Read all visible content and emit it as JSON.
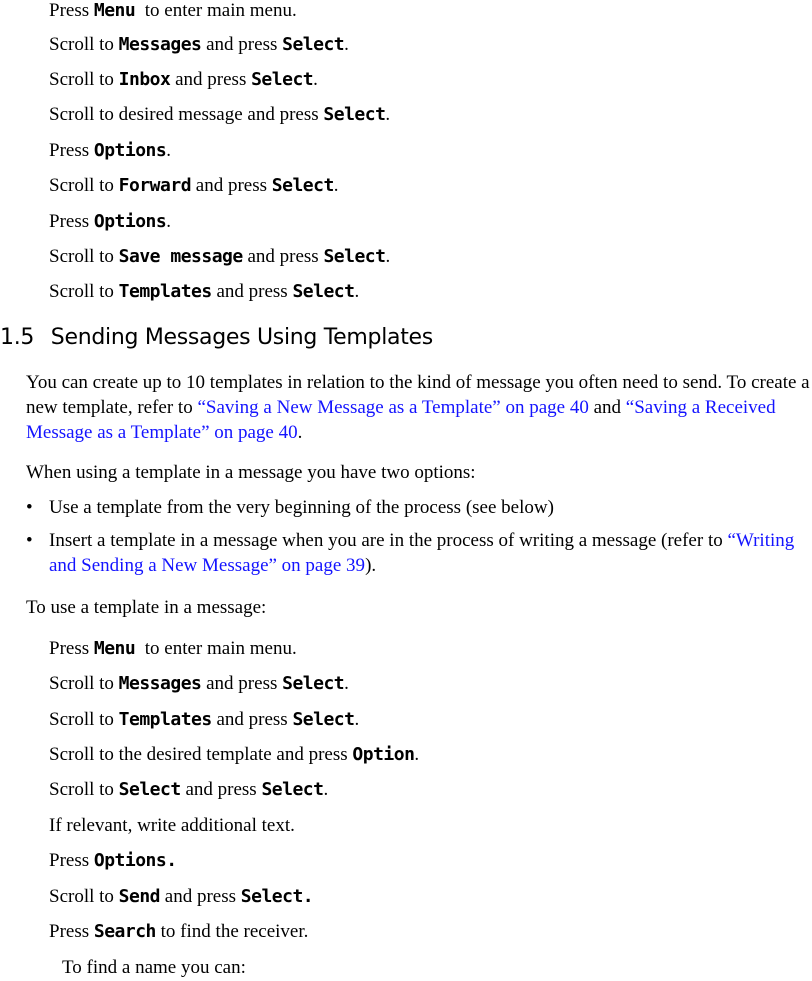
{
  "top_steps": [
    {
      "pre": "Press ",
      "key1": "Menu",
      "mid": "  to enter main menu.",
      "key2": "",
      "post": ""
    },
    {
      "pre": "Scroll to ",
      "key1": "Messages",
      "mid": " and press ",
      "key2": "Select",
      "post": "."
    },
    {
      "pre": "Scroll to ",
      "key1": "Inbox",
      "mid": " and press ",
      "key2": "Select",
      "post": "."
    },
    {
      "pre": "Scroll to desired message and press ",
      "key1": "Select",
      "mid": ".",
      "key2": "",
      "post": ""
    },
    {
      "pre": "Press ",
      "key1": "Options",
      "mid": ".",
      "key2": "",
      "post": ""
    },
    {
      "pre": "Scroll to ",
      "key1": "Forward",
      "mid": " and press ",
      "key2": "Select",
      "post": "."
    },
    {
      "pre": "Press ",
      "key1": "Options",
      "mid": ".",
      "key2": "",
      "post": ""
    },
    {
      "pre": "Scroll to ",
      "key1": "Save message",
      "mid": " and press ",
      "key2": "Select",
      "post": "."
    },
    {
      "pre": "Scroll to ",
      "key1": "Templates",
      "mid": " and press ",
      "key2": "Select",
      "post": "."
    }
  ],
  "section": {
    "number": "1.5",
    "title": "Sending Messages Using Templates"
  },
  "intro": {
    "text1": "You can create up to 10 templates in relation to the kind of message you often need to send. To create a new template, refer to ",
    "link1": "“Saving a New Message as a Template” on page 40",
    "text2": " and ",
    "link2": "“Saving a Received Message as a Template” on page 40",
    "text3": "."
  },
  "options_intro": "When using a template in a message you have two options:",
  "bullets": {
    "b1": "Use a template from the very beginning of the process (see below)",
    "b2_text": "Insert a template in a message when you are in the process of writing a message (refer to ",
    "b2_link": "“Writing and Sending a New Message” on page 39",
    "b2_end": ").",
    "dot": "•"
  },
  "use_intro": "To use a template in a message:",
  "bottom_steps": [
    {
      "pre": "Press ",
      "key1": "Menu",
      "mid": "  to enter main menu.",
      "key2": "",
      "post": ""
    },
    {
      "pre": "Scroll to ",
      "key1": "Messages",
      "mid": " and press ",
      "key2": "Select",
      "post": "."
    },
    {
      "pre": "Scroll to ",
      "key1": "Templates",
      "mid": " and press ",
      "key2": "Select",
      "post": "."
    },
    {
      "pre": "Scroll to the desired template and press ",
      "key1": "Option",
      "mid": ".",
      "key2": "",
      "post": ""
    },
    {
      "pre": "Scroll to ",
      "key1": "Select",
      "mid": " and press ",
      "key2": "Select",
      "post": "."
    },
    {
      "pre": "If relevant, write additional text.",
      "key1": "",
      "mid": "",
      "key2": "",
      "post": ""
    },
    {
      "pre": "Press ",
      "key1": "Options.",
      "mid": "",
      "key2": "",
      "post": ""
    },
    {
      "pre": "Scroll to ",
      "key1": "Send",
      "mid": " and press ",
      "key2": "Select.",
      "post": ""
    },
    {
      "pre": "Press ",
      "key1": "Search",
      "mid": " to find the receiver.",
      "key2": "",
      "post": ""
    }
  ],
  "find_name": "To find a name you can:",
  "colors": {
    "link": "#1414ff",
    "text": "#000000"
  }
}
